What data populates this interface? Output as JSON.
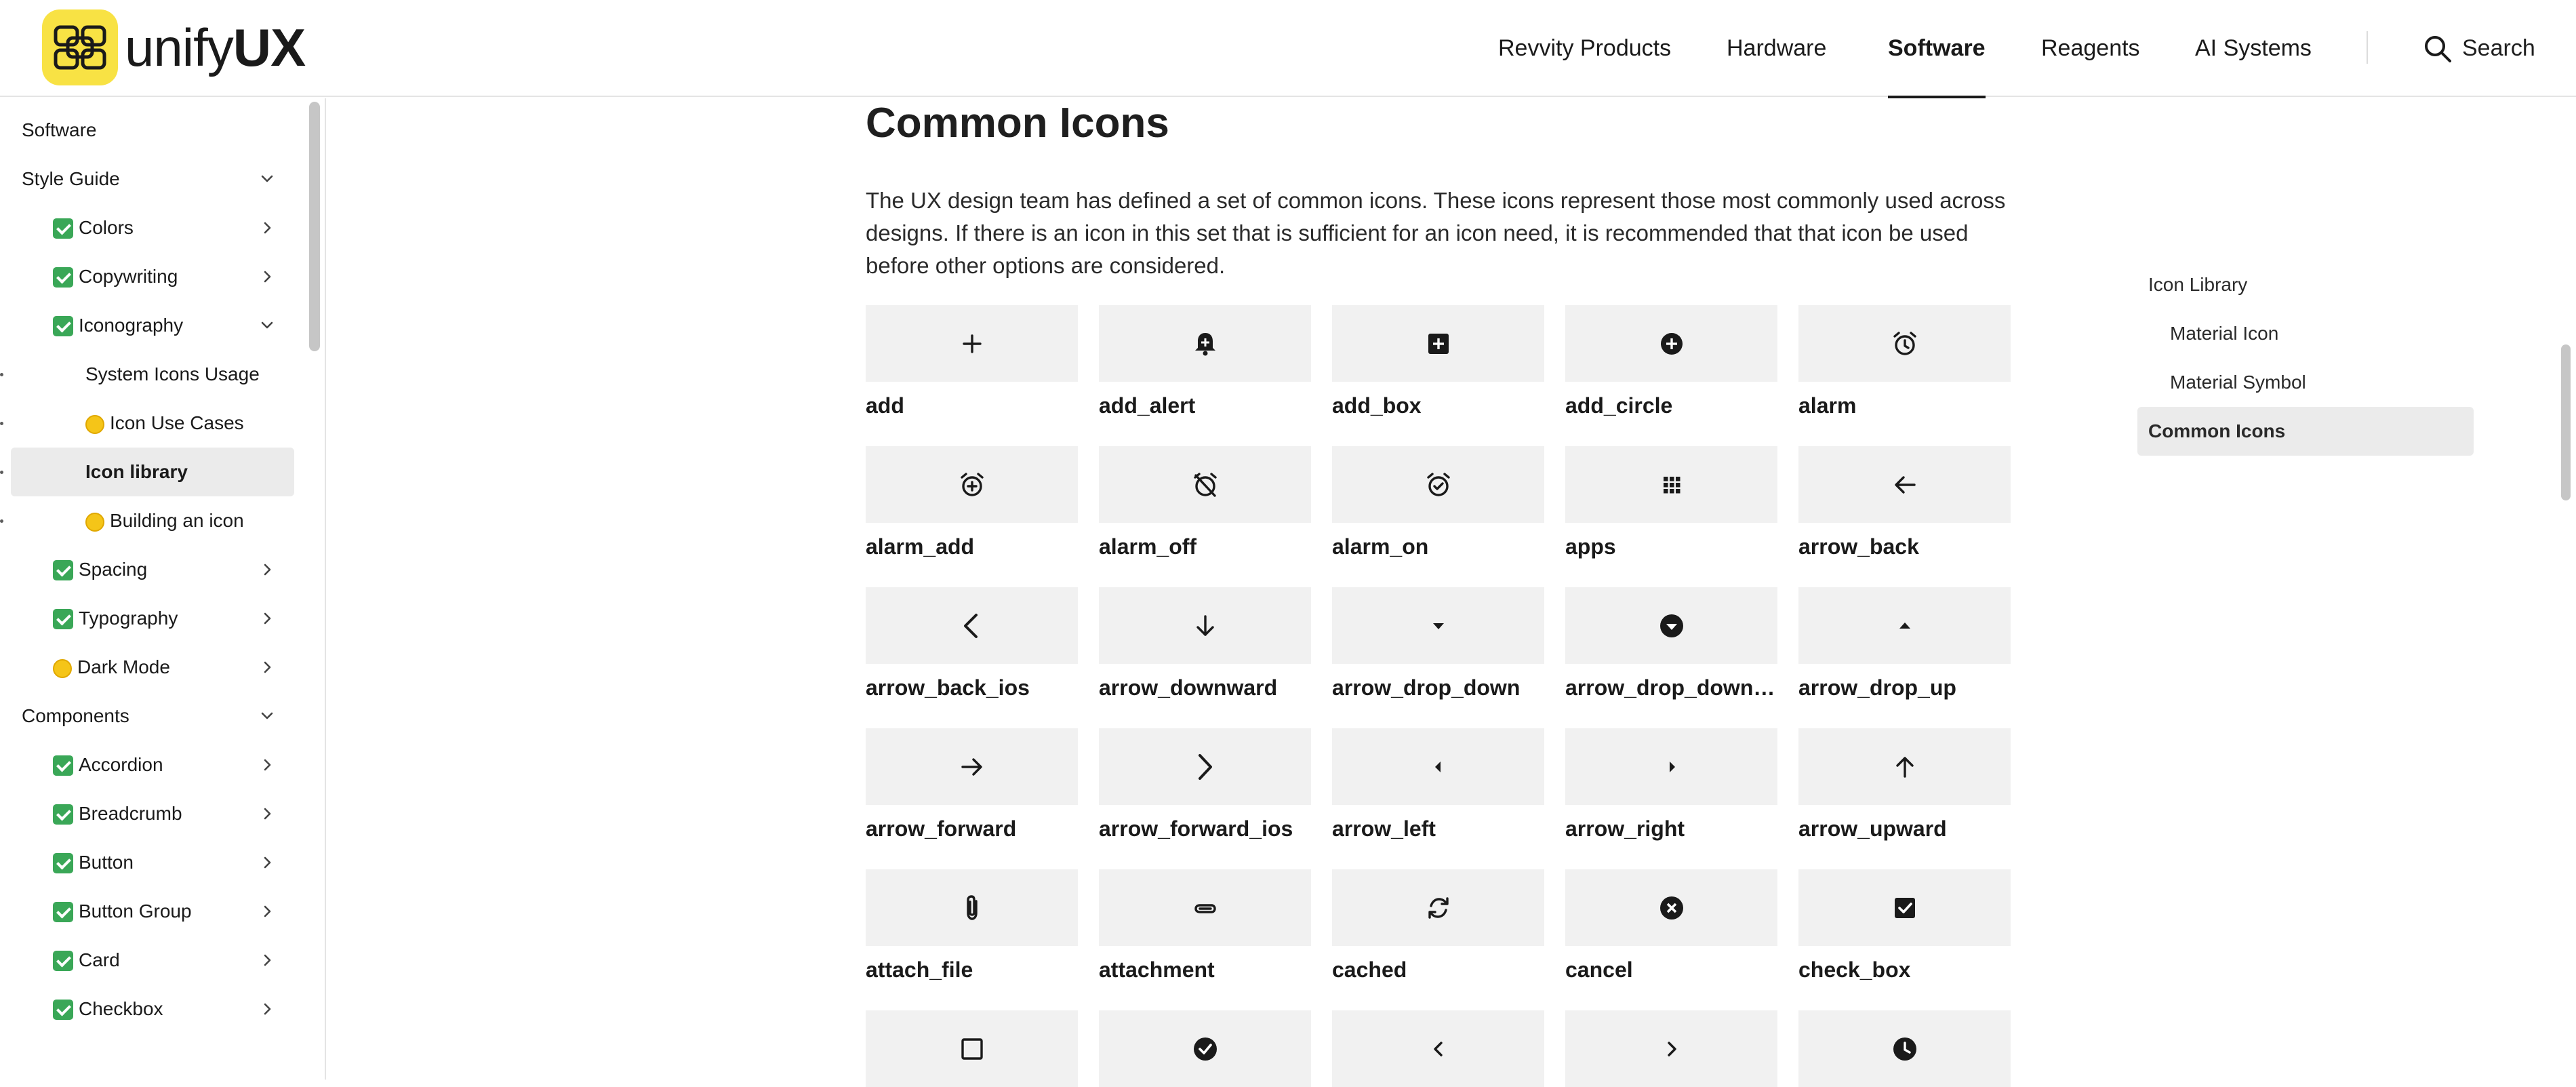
{
  "brand": {
    "name_light": "unify",
    "name_bold": "UX",
    "logo_color": "#f8e244"
  },
  "nav": {
    "items": [
      "Revvity Products",
      "Hardware",
      "Software",
      "Reagents",
      "AI Systems"
    ],
    "active": "Software",
    "search_label": "Search"
  },
  "sidebar": {
    "items": [
      {
        "label": "Software",
        "level": 0,
        "chevron": "none"
      },
      {
        "label": "Style Guide",
        "level": 0,
        "chevron": "down"
      },
      {
        "label": "Colors",
        "level": 1,
        "status": "check",
        "chevron": "right"
      },
      {
        "label": "Copywriting",
        "level": 1,
        "status": "check",
        "chevron": "right"
      },
      {
        "label": "Iconography",
        "level": 1,
        "status": "check",
        "chevron": "down"
      },
      {
        "label": "System Icons Usage",
        "level": 2,
        "status": "none",
        "chevron": "none"
      },
      {
        "label": "Icon Use Cases",
        "level": 2,
        "status": "dot",
        "chevron": "none"
      },
      {
        "label": "Icon library",
        "level": 2,
        "status": "none",
        "chevron": "none",
        "selected": true
      },
      {
        "label": "Building an icon",
        "level": 2,
        "status": "dot",
        "chevron": "none"
      },
      {
        "label": "Spacing",
        "level": 1,
        "status": "check",
        "chevron": "right"
      },
      {
        "label": "Typography",
        "level": 1,
        "status": "check",
        "chevron": "right"
      },
      {
        "label": "Dark Mode",
        "level": 1,
        "status": "dot",
        "chevron": "right"
      },
      {
        "label": "Components",
        "level": 0,
        "chevron": "down"
      },
      {
        "label": "Accordion",
        "level": 1,
        "status": "check",
        "chevron": "right"
      },
      {
        "label": "Breadcrumb",
        "level": 1,
        "status": "check",
        "chevron": "right"
      },
      {
        "label": "Button",
        "level": 1,
        "status": "check",
        "chevron": "right"
      },
      {
        "label": "Button Group",
        "level": 1,
        "status": "check",
        "chevron": "right"
      },
      {
        "label": "Card",
        "level": 1,
        "status": "check",
        "chevron": "right"
      },
      {
        "label": "Checkbox",
        "level": 1,
        "status": "check",
        "chevron": "right"
      }
    ]
  },
  "main": {
    "title": "Common Icons",
    "intro": "The UX design team has defined a set of common icons. These icons represent those most commonly used across designs. If there is an icon in this set that is sufficient for an icon need, it is recommended that that icon be used before other options are considered.",
    "icons": [
      {
        "label": "add",
        "icon": "add-icon"
      },
      {
        "label": "add_alert",
        "icon": "add-alert-icon"
      },
      {
        "label": "add_box",
        "icon": "add-box-icon"
      },
      {
        "label": "add_circle",
        "icon": "add-circle-icon"
      },
      {
        "label": "alarm",
        "icon": "alarm-icon"
      },
      {
        "label": "alarm_add",
        "icon": "alarm-add-icon"
      },
      {
        "label": "alarm_off",
        "icon": "alarm-off-icon"
      },
      {
        "label": "alarm_on",
        "icon": "alarm-on-icon"
      },
      {
        "label": "apps",
        "icon": "apps-icon"
      },
      {
        "label": "arrow_back",
        "icon": "arrow-back-icon"
      },
      {
        "label": "arrow_back_ios",
        "icon": "arrow-back-ios-icon"
      },
      {
        "label": "arrow_downward",
        "icon": "arrow-downward-icon"
      },
      {
        "label": "arrow_drop_down",
        "icon": "arrow-drop-down-icon"
      },
      {
        "label": "arrow_drop_down_...",
        "icon": "arrow-drop-down-circle-icon"
      },
      {
        "label": "arrow_drop_up",
        "icon": "arrow-drop-up-icon"
      },
      {
        "label": "arrow_forward",
        "icon": "arrow-forward-icon"
      },
      {
        "label": "arrow_forward_ios",
        "icon": "arrow-forward-ios-icon"
      },
      {
        "label": "arrow_left",
        "icon": "arrow-left-icon"
      },
      {
        "label": "arrow_right",
        "icon": "arrow-right-icon"
      },
      {
        "label": "arrow_upward",
        "icon": "arrow-upward-icon"
      },
      {
        "label": "attach_file",
        "icon": "attach-file-icon"
      },
      {
        "label": "attachment",
        "icon": "attachment-icon"
      },
      {
        "label": "cached",
        "icon": "cached-icon"
      },
      {
        "label": "cancel",
        "icon": "cancel-icon"
      },
      {
        "label": "check_box",
        "icon": "check-box-icon"
      },
      {
        "label": "",
        "icon": "check-box-outline-blank-icon"
      },
      {
        "label": "",
        "icon": "check-circle-icon"
      },
      {
        "label": "",
        "icon": "chevron-left-icon"
      },
      {
        "label": "",
        "icon": "chevron-right-icon"
      },
      {
        "label": "",
        "icon": "clock-icon"
      }
    ]
  },
  "toc": {
    "items": [
      {
        "label": "Icon Library",
        "sub": false
      },
      {
        "label": "Material Icon",
        "sub": true
      },
      {
        "label": "Material Symbol",
        "sub": true
      },
      {
        "label": "Common Icons",
        "sub": false,
        "selected": true
      }
    ]
  }
}
